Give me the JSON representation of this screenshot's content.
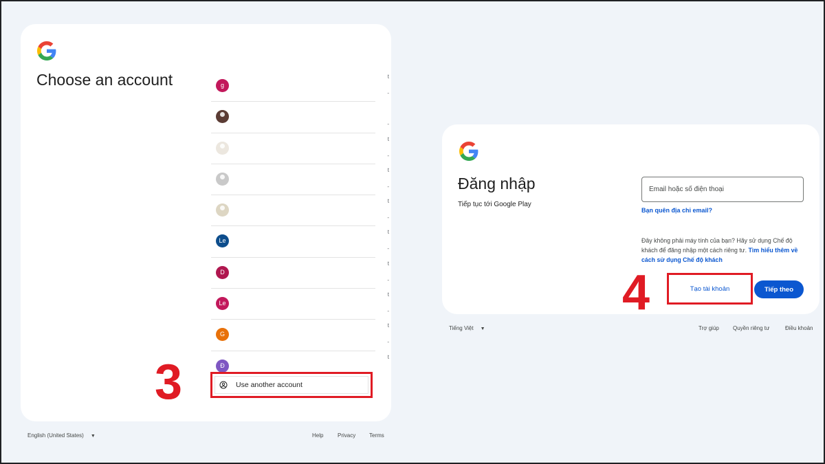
{
  "left_panel": {
    "title": "Choose an account",
    "accounts": [
      {
        "avatar_text": "g",
        "avatar_color": "#c2185b",
        "mark": "t",
        "dash": "-"
      },
      {
        "avatar_text": "",
        "avatar_kind": "photo-dark",
        "mark": "",
        "dash": "-"
      },
      {
        "avatar_text": "",
        "avatar_kind": "photo-light",
        "mark": "t",
        "dash": "-"
      },
      {
        "avatar_text": "",
        "avatar_kind": "photo-grey",
        "mark": "t",
        "dash": "-"
      },
      {
        "avatar_text": "",
        "avatar_kind": "photo-sand",
        "mark": "t",
        "dash": "-"
      },
      {
        "avatar_text": "Le",
        "avatar_color": "#0d4d8c",
        "mark": "t",
        "dash": "-"
      },
      {
        "avatar_text": "D",
        "avatar_color": "#b0174f",
        "mark": "t",
        "dash": "-"
      },
      {
        "avatar_text": "Le",
        "avatar_color": "#c2185b",
        "mark": "t",
        "dash": "-"
      },
      {
        "avatar_text": "G",
        "avatar_color": "#e8710a",
        "mark": "t",
        "dash": "-"
      },
      {
        "avatar_text": "Đ",
        "avatar_color": "#7e57c2",
        "mark": "t",
        "dash": ""
      }
    ],
    "use_another_label": "Use another account",
    "step_number": "3",
    "footer": {
      "language": "English (United States)",
      "help": "Help",
      "privacy": "Privacy",
      "terms": "Terms"
    }
  },
  "right_panel": {
    "title": "Đăng nhập",
    "subtitle": "Tiếp tục tới Google Play",
    "email_placeholder": "Email hoặc số điện thoại",
    "forgot_email": "Bạn quên địa chỉ email?",
    "guest_note_text": "Đây không phải máy tính của bạn? Hãy sử dụng Chế độ khách để đăng nhập một cách riêng tư.",
    "guest_link": "Tìm hiểu thêm về cách sử dụng Chế độ khách",
    "create_account": "Tạo tài khoản",
    "next": "Tiếp theo",
    "step_number": "4",
    "footer": {
      "language": "Tiếng Việt",
      "help": "Trợ giúp",
      "privacy": "Quyền riêng tư",
      "terms": "Điều khoản"
    }
  },
  "colors": {
    "page_bg": "#f0f4f9",
    "highlight_red": "#e01b24",
    "google_blue": "#0b57d0"
  }
}
